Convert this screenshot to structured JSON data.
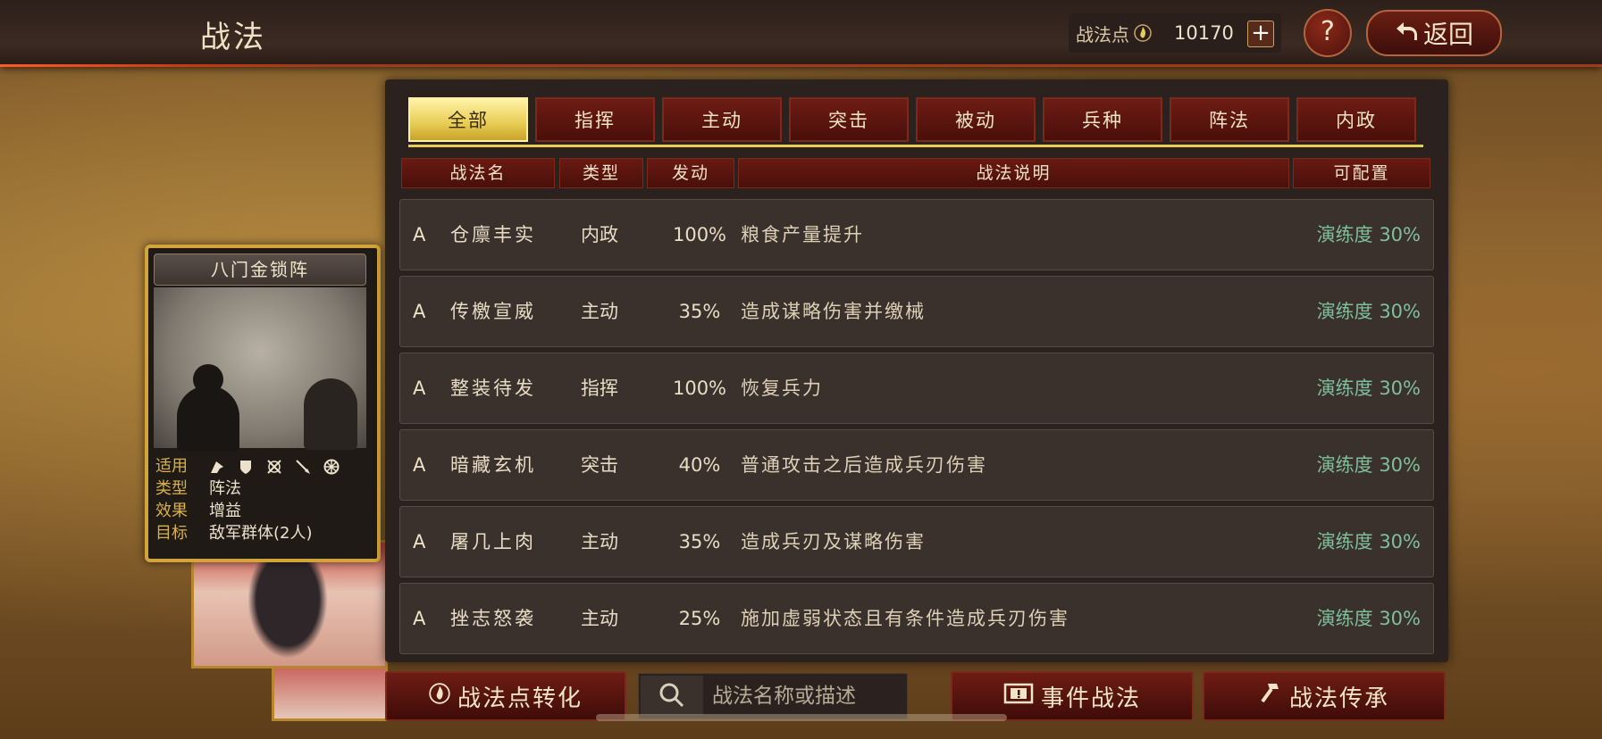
{
  "header": {
    "title": "战法",
    "points_label": "战法点",
    "points_value": "10170",
    "plus": "+",
    "help": "?",
    "back_label": "返回",
    "icons": [
      "flame-icon",
      "return-arrow-icon"
    ]
  },
  "tabs": [
    {
      "label": "全部",
      "active": true
    },
    {
      "label": "指挥",
      "active": false
    },
    {
      "label": "主动",
      "active": false
    },
    {
      "label": "突击",
      "active": false
    },
    {
      "label": "被动",
      "active": false
    },
    {
      "label": "兵种",
      "active": false
    },
    {
      "label": "阵法",
      "active": false
    },
    {
      "label": "内政",
      "active": false
    }
  ],
  "columns": {
    "name": "战法名",
    "type": "类型",
    "rate": "发动",
    "desc": "战法说明",
    "config": "可配置"
  },
  "rows": [
    {
      "grade": "A",
      "name": "仓廪丰实",
      "type": "内政",
      "rate": "100%",
      "desc": "粮食产量提升",
      "config": "演练度 30%"
    },
    {
      "grade": "A",
      "name": "传檄宣威",
      "type": "主动",
      "rate": "35%",
      "desc": "造成谋略伤害并缴械",
      "config": "演练度 30%"
    },
    {
      "grade": "A",
      "name": "整装待发",
      "type": "指挥",
      "rate": "100%",
      "desc": "恢复兵力",
      "config": "演练度 30%"
    },
    {
      "grade": "A",
      "name": "暗藏玄机",
      "type": "突击",
      "rate": "40%",
      "desc": "普通攻击之后造成兵刃伤害",
      "config": "演练度 30%"
    },
    {
      "grade": "A",
      "name": "屠几上肉",
      "type": "主动",
      "rate": "35%",
      "desc": "造成兵刃及谋略伤害",
      "config": "演练度 30%"
    },
    {
      "grade": "A",
      "name": "挫志怒袭",
      "type": "主动",
      "rate": "25%",
      "desc": "施加虚弱状态且有条件造成兵刃伤害",
      "config": "演练度 30%"
    }
  ],
  "card": {
    "title": "八门金锁阵",
    "apply_label": "适用",
    "apply_icons": [
      "cavalry-icon",
      "shield-icon",
      "archer-icon",
      "spear-icon",
      "wheel-icon"
    ],
    "type_label": "类型",
    "type_value": "阵法",
    "effect_label": "效果",
    "effect_value": "增益",
    "target_label": "目标",
    "target_value": "敌军群体(2人)"
  },
  "footer": {
    "convert_label": "战法点转化",
    "search_placeholder": "战法名称或描述",
    "event_label": "事件战法",
    "inherit_label": "战法传承",
    "icons": [
      "flame-icon",
      "search-icon",
      "event-icon",
      "hammer-icon"
    ]
  },
  "colors": {
    "accent_gold": "#e8cc54",
    "button_red": "#6e1c14",
    "config_green": "#7fbf9a"
  }
}
